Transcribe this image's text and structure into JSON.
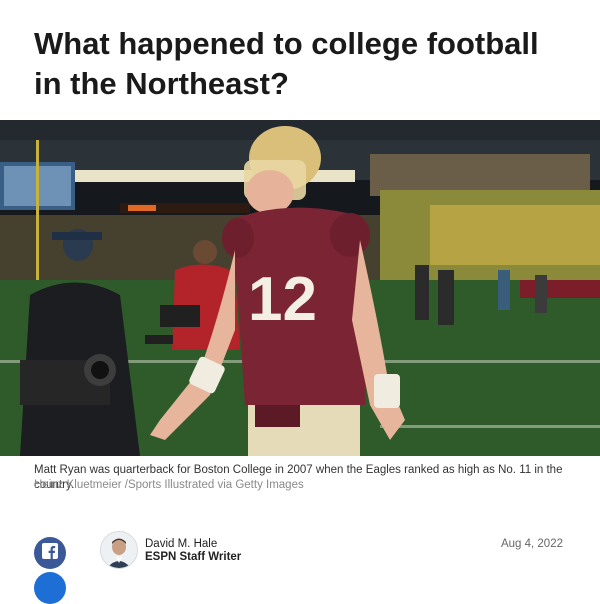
{
  "article": {
    "title": "What happened to college football in the Northeast?",
    "photo": {
      "caption": "Matt Ryan was quarterback for Boston College in 2007 when the Eagles ranked as high as No. 11 in the country.",
      "credit": "Heinz Kluetmeier /Sports Illustrated via Getty Images",
      "jersey_number": "12"
    },
    "byline": {
      "author": "David M. Hale",
      "role": "ESPN Staff Writer",
      "date": "Aug 4, 2022"
    },
    "share": {
      "facebook_icon": "facebook-icon"
    }
  }
}
